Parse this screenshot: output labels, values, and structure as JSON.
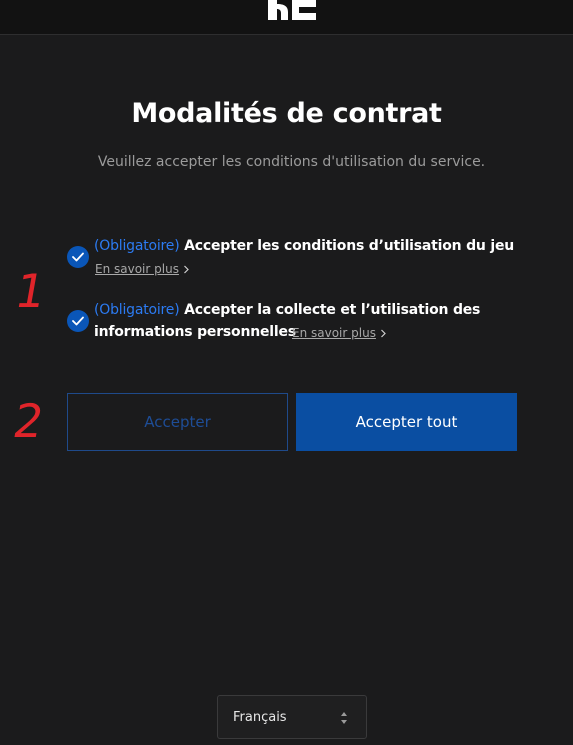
{
  "header": {
    "logo_icon": "nc-logo-icon"
  },
  "main": {
    "title": "Modalités de contrat",
    "subtitle": "Veuillez accepter les conditions d'utilisation du service."
  },
  "terms": [
    {
      "checked": true,
      "required_tag": "(Obligatoire)",
      "text_line1": "Accepter les conditions d’utilisation du jeu",
      "learn_more": "En savoir plus"
    },
    {
      "checked": true,
      "required_tag": "(Obligatoire)",
      "text_line1": "Accepter la collecte et l’utilisation des",
      "text_line2": "informations personnelles",
      "learn_more": "En savoir plus"
    }
  ],
  "annotations": {
    "mark_1": "1",
    "mark_2": "2",
    "color": "#e0242a"
  },
  "buttons": {
    "accept": "Accepter",
    "accept_all": "Accepter tout"
  },
  "language_select": {
    "selected": "Français",
    "icon": "up-down-arrows-icon"
  },
  "colors": {
    "background": "#1b1b1c",
    "accent_blue": "#0a4ea2",
    "link_blue": "#2c7bf2"
  }
}
